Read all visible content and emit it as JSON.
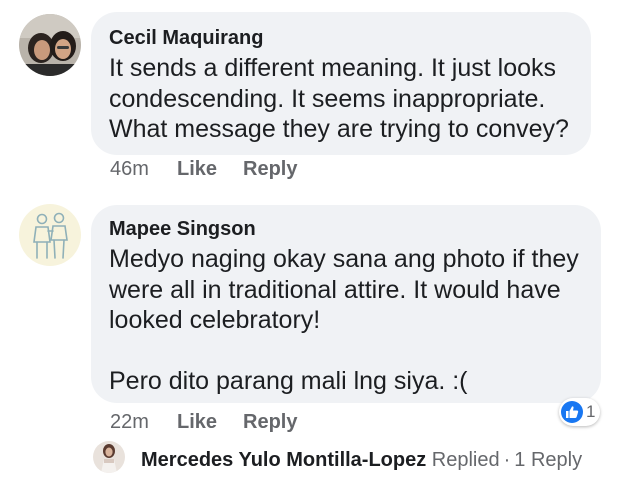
{
  "comments": [
    {
      "author": "Cecil Maquirang",
      "lines": [
        "It sends a different meaning.  It just looks",
        "condescending. It seems inappropriate.",
        "What message they are trying to convey?"
      ],
      "time": "46m",
      "like_label": "Like",
      "reply_label": "Reply",
      "avatar_icon": "profile-photo-icon"
    },
    {
      "author": "Mapee Singson",
      "lines": [
        "Medyo naging okay sana ang photo if they",
        "were all in traditional attire. It would have",
        "looked celebratory!",
        "",
        "Pero dito parang mali lng siya. :("
      ],
      "time": "22m",
      "like_label": "Like",
      "reply_label": "Reply",
      "avatar_icon": "couple-illustration-icon",
      "reactions": {
        "icon": "like-reaction-icon",
        "count": "1"
      }
    }
  ],
  "reply_summary": {
    "name": "Mercedes Yulo Montilla-Lopez",
    "status": "Replied",
    "separator": "·",
    "count": "1 Reply",
    "avatar_icon": "profile-photo-icon"
  },
  "colors": {
    "bubble": "#f0f2f5",
    "text": "#1c1e21",
    "meta": "#65676b",
    "like_blue": "#1877f2"
  }
}
